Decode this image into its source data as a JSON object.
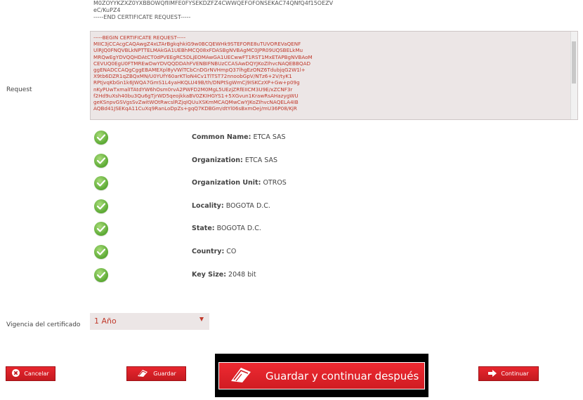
{
  "csr_top_lines": [
    "M0ZOYYKZXZ0YXBBOWQfIIMFE0FYSEKDZFZ4CWWQEFOFONSEKAC74QNfQ4f15OEZV",
    "eC/KuPZ4",
    "-----END CERTIFICATE REQUEST-----"
  ],
  "request_label": "Request",
  "request_lines": [
    "-----BEGIN CERTIFICATE REQUEST-----",
    "MIIC3jCCAcgCAQAwgZ4xLTArBgkqhkiG9w0BCQEWHk9STEFORE8uTUVOREVaQENF",
    "UlRJQ0FNQVBLkNPTTELMAkGA1UEBhMCQ08xFDASBgNVBAgMC0JPR09UQSBELkMu",
    "MRQwEgYDVQQHDAtCT0dPVEEgRC5DLjEOMAwGA1UECwwFT1RST1MxETAPBgNVBAoM",
    "CEVUQ0EgU0FTMREwDwYDVQQDDAhFVENBIFNBUzCCASAwDQYJKoZIhvcNAQEBBQAD",
    "ggENADCCAQgCggEBAMEXpl8yVWlTCbCnDGrNVHmpQ37lhgEzONZ6TdubjqG2W1l+",
    "X9tb6DZR1qZBQxMN/U0YUfY60arKTloN4Cv1TlTST72nnoobGpV/NTz6+2V/tyK1",
    "RPtjvqKbGn1k6JWQA7GmS1L4yaHKQLU49B/th/DNPtSgWmCj9ISKCzXP+Gw+p09g",
    "nKyPUwTxmalITAtdYW6hOsm0rvA2PWFD2M0MgL5UEzjZRfEIICM3U9E/xZCNF3r",
    "f2Hd9uXsh40bu3Qu6gTjrWD5qeojkkaBV0ZKIHGYS1+5XGvun1KrawRsAHazygWU",
    "geKSnpvGSVgsSvZwitWOtRwcslRZjqIQUuXSKmMCAQMwCwYJKoZIhvcNAQELA4IB",
    "AQBd41JSEKqA11CuXq9RanLoDpZs+gqQ7KDBGm/dtYl06sBxmOej/mU36P08/KjR"
  ],
  "checks": [
    {
      "label": "Common Name:",
      "value": "ETCA SAS"
    },
    {
      "label": "Organization:",
      "value": "ETCA SAS"
    },
    {
      "label": "Organization Unit:",
      "value": "OTROS"
    },
    {
      "label": "Locality:",
      "value": "BOGOTA D.C."
    },
    {
      "label": "State:",
      "value": "BOGOTA D.C."
    },
    {
      "label": "Country:",
      "value": "CO"
    },
    {
      "label": "Key Size:",
      "value": "2048 bit"
    }
  ],
  "vigencia": {
    "label": "Vigencia del certificado",
    "selected": "1 Año"
  },
  "buttons": {
    "cancel": "Cancelar",
    "save": "Guardar",
    "save_continue_later": "Guardar y continuar después",
    "continue": "Continuar"
  },
  "colors": {
    "accent_red": "#d8232a",
    "check_green": "#5aa832",
    "field_bg": "#ece6e6"
  }
}
